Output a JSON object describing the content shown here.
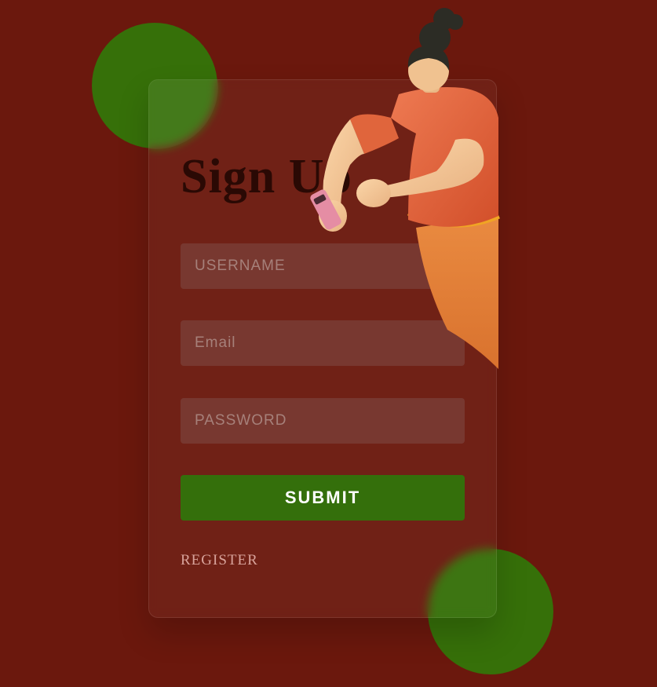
{
  "signup": {
    "title": "Sign Up",
    "username_placeholder": "USERNAME",
    "email_placeholder": "Email",
    "password_placeholder": "PASSWORD",
    "submit_label": "SUBMIT",
    "register_label": "REGISTER"
  },
  "colors": {
    "background": "#6b180d",
    "accent": "#346f0b",
    "field": "#783830"
  },
  "icons": {
    "illustration": "person-with-phone-illustration"
  }
}
